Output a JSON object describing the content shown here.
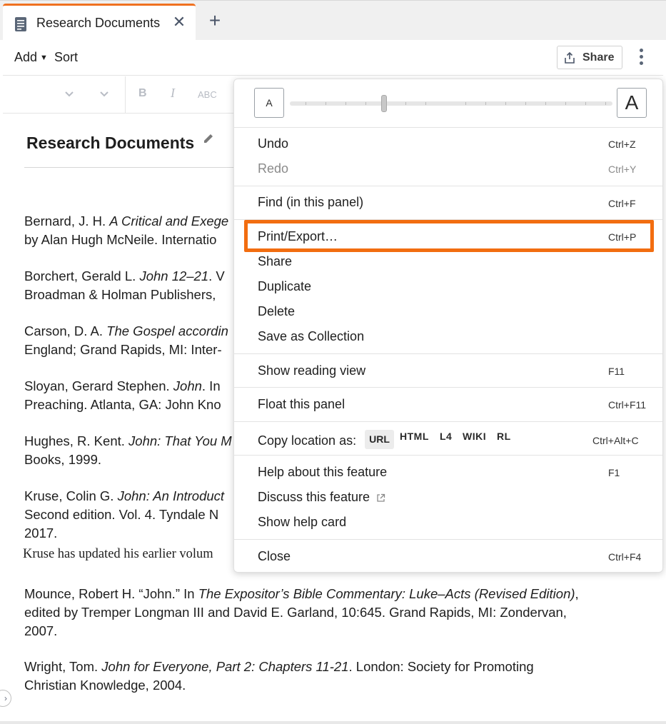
{
  "tab": {
    "title": "Research Documents",
    "close_glyph": "✕",
    "new_glyph": "+"
  },
  "toolbar": {
    "add_label": "Add",
    "add_caret": "▼",
    "sort_label": "Sort",
    "share_label": "Share"
  },
  "format_bar": {
    "bold": "B",
    "italic": "I",
    "strike": "ABC"
  },
  "document": {
    "title": "Research Documents",
    "entries": [
      {
        "prefix": "Bernard, J. H. ",
        "italic": "A Critical and Exege",
        "rest": "",
        "line2": "by Alan Hugh McNeile. Internatio"
      },
      {
        "prefix": "Borchert, Gerald L. ",
        "italic": "John 12–21",
        "rest": ". V",
        "line2": "Broadman & Holman Publishers,"
      },
      {
        "prefix": "Carson, D. A. ",
        "italic": "The Gospel accordin",
        "rest": "",
        "line2": "England; Grand Rapids, MI: Inter-"
      },
      {
        "prefix": "Sloyan, Gerard Stephen. ",
        "italic": "John",
        "rest": ". In",
        "line2": "Preaching. Atlanta, GA: John Kno"
      },
      {
        "prefix": "Hughes, R. Kent. ",
        "italic": "John: That You M",
        "rest": "",
        "line2": "Books, 1999."
      },
      {
        "prefix": "Kruse, Colin G. ",
        "italic": "John: An Introduct",
        "rest": "",
        "line2": "Second edition. Vol. 4. Tyndale N",
        "line3": "2017."
      },
      {
        "prefix": "Mounce, Robert H. “John.” In ",
        "italic": "The Expositor’s Bible Commentary: Luke–Acts (Revised Edition)",
        "rest": ",",
        "line2": "edited by Tremper Longman III and David E. Garland, 10:645. Grand Rapids, MI: Zondervan,",
        "line3": "2007."
      },
      {
        "prefix": "Wright, Tom. ",
        "italic": "John for Everyone, Part 2: Chapters 11-21",
        "rest": ". London: Society for Promoting",
        "line2": "Christian Knowledge, 2004."
      }
    ],
    "note": "Kruse has updated his earlier volum"
  },
  "menu": {
    "zoom_small": "A",
    "zoom_large": "A",
    "items": {
      "undo": {
        "label": "Undo",
        "key": "Ctrl+Z"
      },
      "redo": {
        "label": "Redo",
        "key": "Ctrl+Y"
      },
      "find": {
        "label": "Find (in this panel)",
        "key": "Ctrl+F"
      },
      "print": {
        "label": "Print/Export…",
        "key": "Ctrl+P"
      },
      "share": {
        "label": "Share"
      },
      "duplicate": {
        "label": "Duplicate"
      },
      "delete": {
        "label": "Delete"
      },
      "save_collection": {
        "label": "Save as Collection"
      },
      "reading_view": {
        "label": "Show reading view",
        "key": "F11"
      },
      "float_panel": {
        "label": "Float this panel",
        "key": "Ctrl+F11"
      },
      "copy_location": {
        "label": "Copy location as:",
        "key": "Ctrl+Alt+C",
        "options": [
          "URL",
          "HTML",
          "L4",
          "WIKI",
          "RL"
        ]
      },
      "help": {
        "label": "Help about this feature",
        "key": "F1"
      },
      "discuss": {
        "label": "Discuss this feature"
      },
      "help_card": {
        "label": "Show help card"
      },
      "close": {
        "label": "Close",
        "key": "Ctrl+F4"
      }
    }
  },
  "colors": {
    "accent_orange": "#f26d10",
    "icon_gray": "#4a5568"
  }
}
